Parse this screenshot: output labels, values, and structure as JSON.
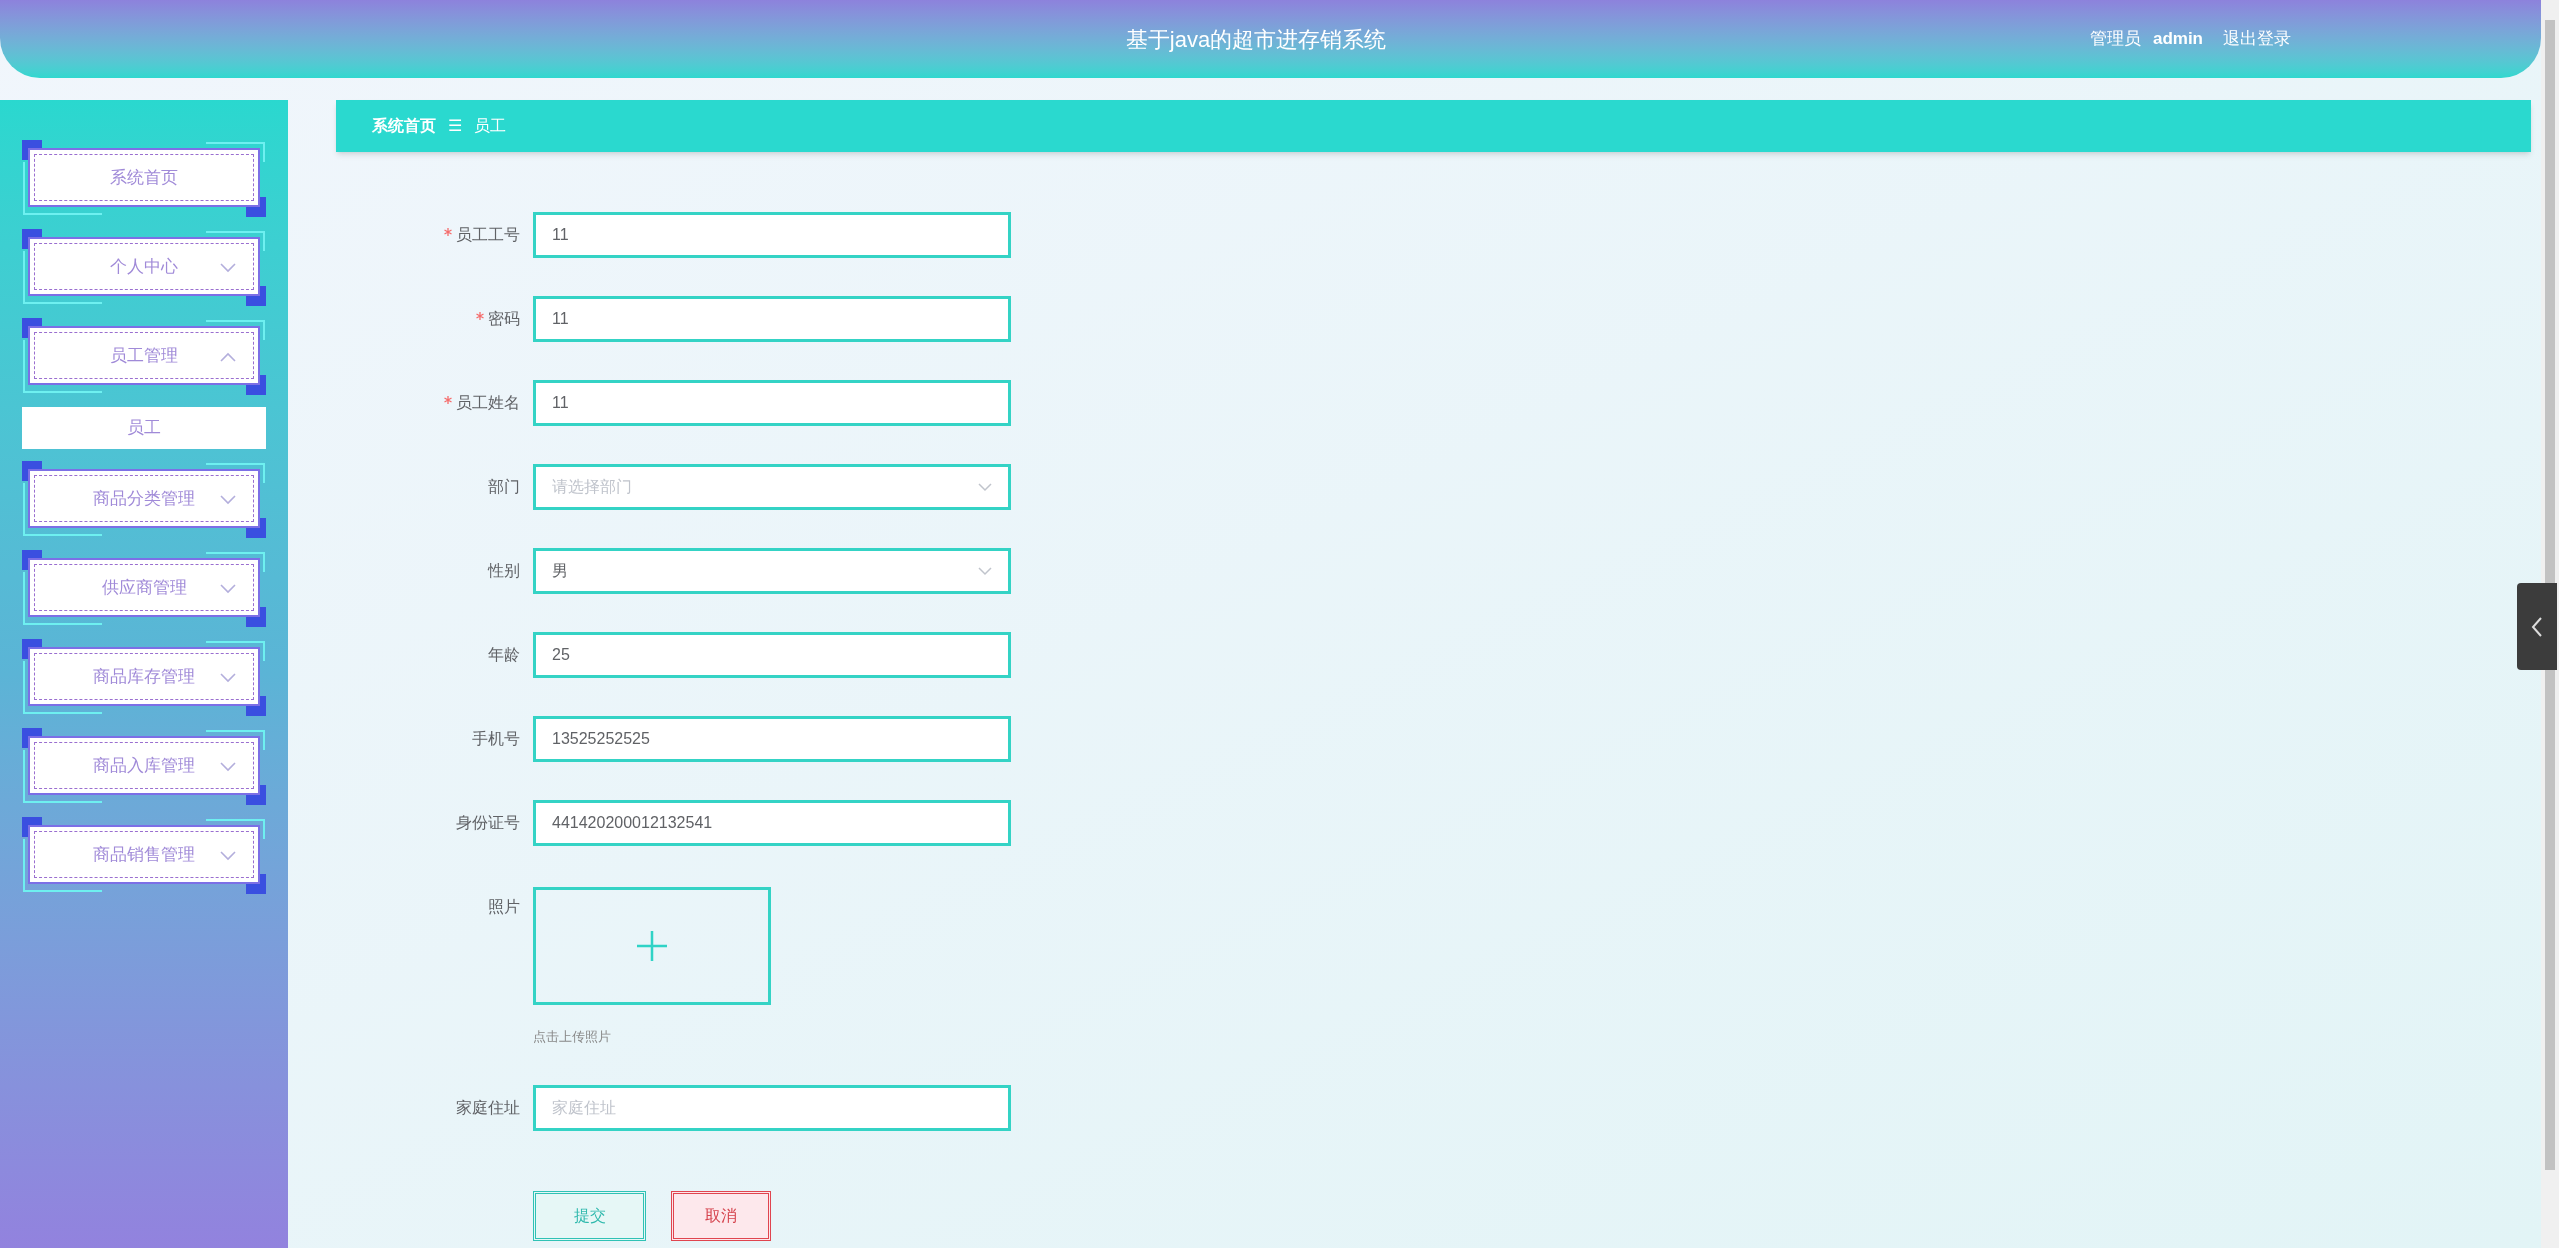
{
  "header": {
    "title": "基于java的超市进存销系统",
    "user_role": "管理员",
    "user_name": "admin",
    "logout": "退出登录"
  },
  "sidebar": {
    "items": [
      {
        "label": "系统首页",
        "kind": "link"
      },
      {
        "label": "个人中心",
        "kind": "submenu",
        "expanded": false
      },
      {
        "label": "员工管理",
        "kind": "submenu",
        "expanded": true,
        "children": [
          {
            "label": "员工"
          }
        ]
      },
      {
        "label": "商品分类管理",
        "kind": "submenu",
        "expanded": false
      },
      {
        "label": "供应商管理",
        "kind": "submenu",
        "expanded": false
      },
      {
        "label": "商品库存管理",
        "kind": "submenu",
        "expanded": false
      },
      {
        "label": "商品入库管理",
        "kind": "submenu",
        "expanded": false
      },
      {
        "label": "商品销售管理",
        "kind": "submenu",
        "expanded": false
      }
    ]
  },
  "breadcrumb": {
    "home": "系统首页",
    "separator": "☰",
    "current": "员工"
  },
  "form": {
    "fields": [
      {
        "label": "员工工号",
        "kind": "input",
        "required": true,
        "value": "11"
      },
      {
        "label": "密码",
        "kind": "input",
        "required": true,
        "value": "11"
      },
      {
        "label": "员工姓名",
        "kind": "input",
        "required": true,
        "value": "11"
      },
      {
        "label": "部门",
        "kind": "select",
        "required": false,
        "placeholder": "请选择部门"
      },
      {
        "label": "性别",
        "kind": "select",
        "required": false,
        "value": "男"
      },
      {
        "label": "年龄",
        "kind": "input",
        "required": false,
        "value": "25"
      },
      {
        "label": "手机号",
        "kind": "input",
        "required": false,
        "value": "13525252525"
      },
      {
        "label": "身份证号",
        "kind": "input",
        "required": false,
        "value": "441420200012132541"
      },
      {
        "label": "照片",
        "kind": "upload",
        "required": false,
        "hint": "点击上传照片"
      },
      {
        "label": "家庭住址",
        "kind": "input",
        "required": false,
        "placeholder": "家庭住址"
      }
    ],
    "buttons": [
      {
        "label": "提交",
        "kind": "primary"
      },
      {
        "label": "取消",
        "kind": "danger"
      }
    ]
  }
}
